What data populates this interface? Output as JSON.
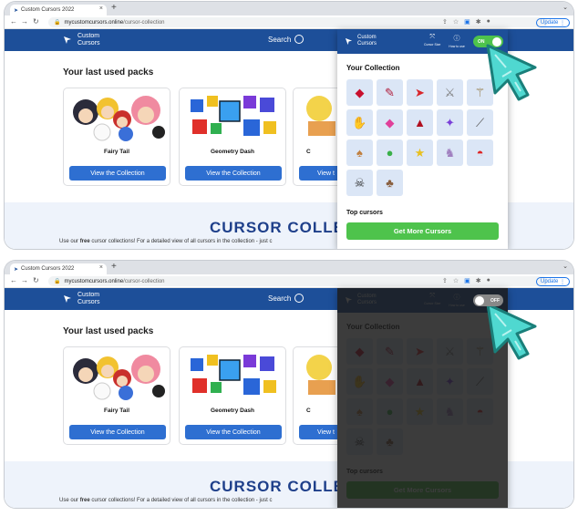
{
  "browser": {
    "tab_title": "Custom Cursors 2022",
    "tab_close": "×",
    "new_tab": "+",
    "url_domain": "mycustomcursors.online",
    "url_path": "/cursor-collection",
    "update_label": "Update"
  },
  "site": {
    "logo_line1": "Custom",
    "logo_line2": "Cursors",
    "search_label": "Search"
  },
  "page": {
    "section_title": "Your last used packs",
    "cards": [
      {
        "name": "Fairy Tail",
        "button": "View the Collection"
      },
      {
        "name": "Geometry Dash",
        "button": "View the Collection"
      },
      {
        "name": "C",
        "button": "View t"
      }
    ],
    "big_title": "CURSOR COLLECT",
    "subtext_pre": "Use our ",
    "subtext_bold": "free",
    "subtext_post": " cursor collections! For a detailed view of all cursors in the collection - just c"
  },
  "popup": {
    "logo_line1": "Custom",
    "logo_line2": "Cursors",
    "cursor_size_label": "Cursor Size",
    "how_to_use_label": "How to use",
    "toggle_on_label": "ON",
    "toggle_off_label": "OFF",
    "collection_title": "Your Collection",
    "top_cursors_title": "Top cursors",
    "get_more_label": "Get More Cursors",
    "collection_icons": [
      "ruby-cursor-icon",
      "gem-brush-cursor-icon",
      "red-arrow-cursor-icon",
      "sword-cursor-icon",
      "staff-cursor-icon",
      "shell-cursor-icon",
      "pink-crystal-cursor-icon",
      "red-triangle-cursor-icon",
      "purple-crystal-cursor-icon",
      "wand-cursor-icon",
      "mushroom-cursor-icon",
      "frog-cursor-icon",
      "pikachu-cursor-icon",
      "mewtwo-cursor-icon",
      "pokeball-cursor-icon",
      "skeleton-cursor-icon",
      "raccoon-cursor-icon"
    ]
  },
  "colors": {
    "header_blue": "#1d4f99",
    "button_blue": "#2e6fd1",
    "green": "#4ec34c",
    "toggle_on": "#4ec34c",
    "toggle_off": "#888888",
    "cell_bg": "#dbe6f6"
  }
}
